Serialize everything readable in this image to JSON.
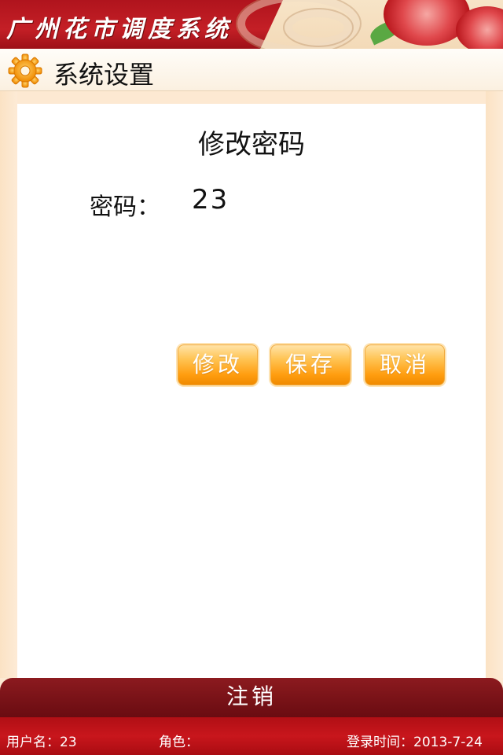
{
  "header": {
    "app_title": "广州花市调度系统"
  },
  "section": {
    "title": "系统设置",
    "icon": "gear-icon"
  },
  "card": {
    "title": "修改密码",
    "password_label": "密码：",
    "password_value": "23"
  },
  "buttons": {
    "edit": "修改",
    "save": "保存",
    "cancel": "取消"
  },
  "logout_label": "注销",
  "footer": {
    "user": "用户名：23",
    "role": "角色：",
    "login_time": "登录时间：2013-7-24"
  },
  "colors": {
    "banner_red": "#c41f26",
    "button_orange": "#ff9d0f",
    "logout_maroon": "#7a1318",
    "page_background": "#fde9d2"
  }
}
